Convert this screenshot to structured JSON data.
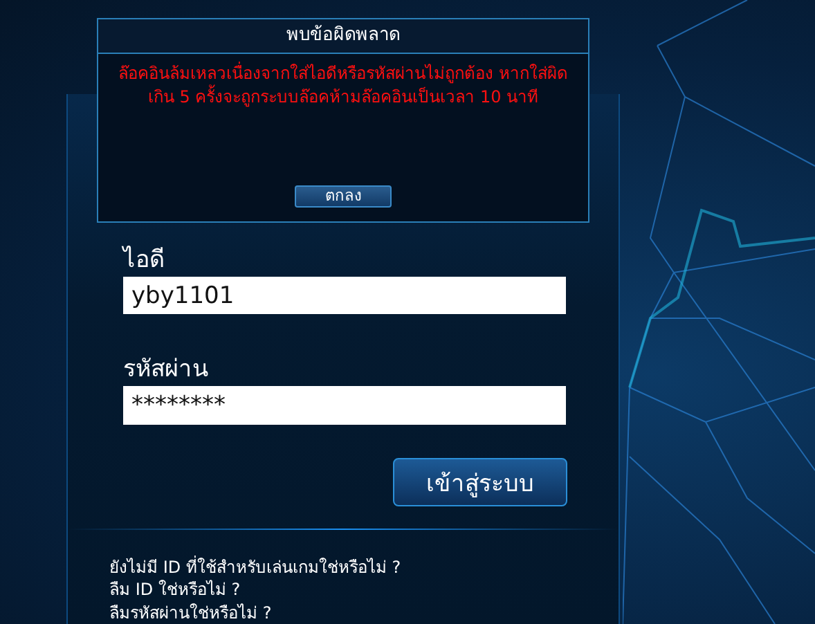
{
  "login_panel": {
    "id_label": "ไอดี",
    "id_value": "yby1101",
    "password_label": "รหัสผ่าน",
    "password_value": "********",
    "login_button": "เข้าสู่ระบบ",
    "links": [
      "ยังไม่มี ID ที่ใช้สำหรับเล่นเกมใช่หรือไม่ ?",
      "ลืม ID ใช่หรือไม่ ?",
      "ลืมรหัสผ่านใช่หรือไม่ ?"
    ]
  },
  "error_dialog": {
    "title": "พบข้อผิดพลาด",
    "message": "ล๊อคอินล้มเหลวเนื่องจากใส่ไอดีหรือรหัสผ่านไม่ถูกต้อง หากใส่ผิดเกิน 5 ครั้งจะถูกระบบล๊อคห้ามล๊อคอินเป็นเวลา 10 นาที",
    "ok_button": "ตกลง"
  }
}
